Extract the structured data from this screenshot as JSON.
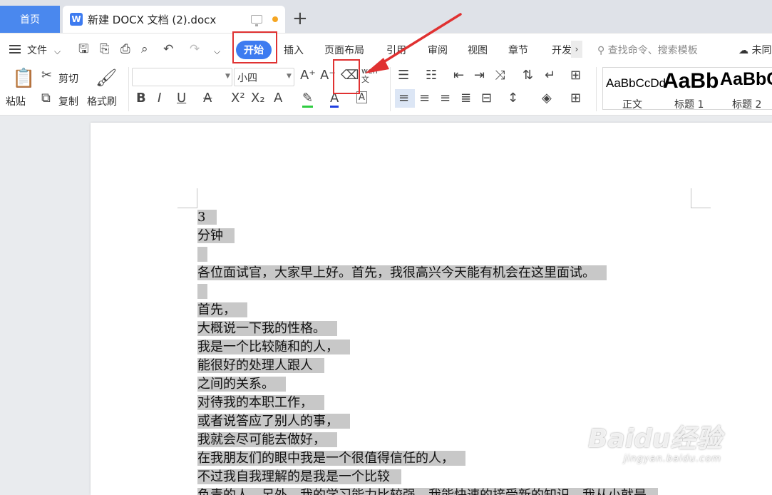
{
  "tabs": {
    "home": "首页",
    "doc_icon": "W",
    "doc_title": "新建 DOCX 文档 (2).docx",
    "new_tab": "+"
  },
  "menu": {
    "file": "文件",
    "items": [
      "开始",
      "插入",
      "页面布局",
      "引用",
      "审阅",
      "视图",
      "章节",
      "开发"
    ],
    "search_placeholder": "查找命令、搜索模板",
    "cloud": "未同"
  },
  "ribbon": {
    "paste": "粘贴",
    "cut": "剪切",
    "copy": "复制",
    "format_painter": "格式刷",
    "font_size": "小四",
    "pinyin": "wen",
    "styles": [
      {
        "sample": "AaBbCcDd",
        "name": "正文"
      },
      {
        "sample": "AaBb",
        "name": "标题 1"
      },
      {
        "sample": "AaBbC",
        "name": "标题 2"
      }
    ]
  },
  "document": {
    "lines": [
      "3",
      "分钟",
      "",
      "各位面试官，大家早上好。首先，我很高兴今天能有机会在这里面试。",
      "",
      "首先，",
      "大概说一下我的性格。",
      "我是一个比较随和的人，",
      "能很好的处理人跟人",
      "之间的关系。",
      "对待我的本职工作，",
      "或者说答应了别人的事，",
      "我就会尽可能去做好，",
      "在我朋友们的眼中我是一个很值得信任的人，",
      "不过我自我理解的是我是一个比较",
      "负责的人。另外，我的学习能力比较强，我能快速的接受新的知识，我从小就是"
    ]
  },
  "watermark": {
    "main": "Baidu经验",
    "sub": "jingyan.baidu.com"
  },
  "colors": {
    "accent": "#3d7bf0",
    "highlight": "#e03131",
    "selection": "#c8c8c8"
  }
}
